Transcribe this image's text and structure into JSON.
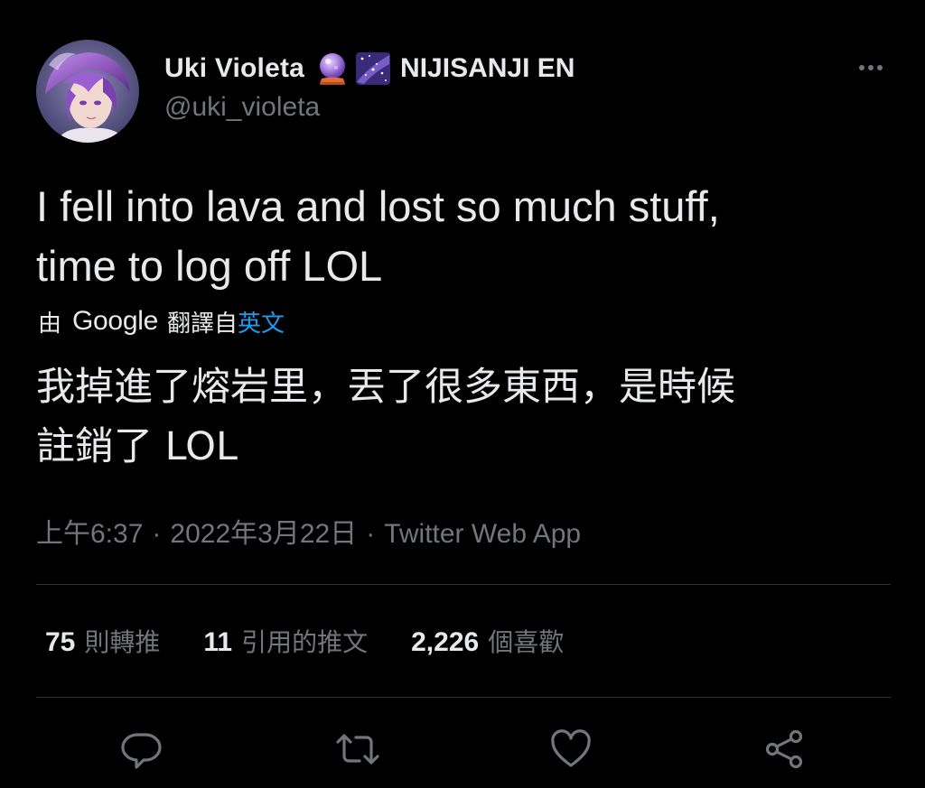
{
  "author": {
    "display_name": "Uki Violeta",
    "affiliation": "NIJISANJI EN",
    "handle": "@uki_violeta",
    "badge_icons": [
      "crystal-ball-icon",
      "milky-way-icon"
    ]
  },
  "tweet": {
    "text_line1": "I fell into lava and lost so much stuff,",
    "text_line2": "time to log off LOL",
    "translation": {
      "prefix": "由",
      "provider": "Google",
      "middle": "翻譯自",
      "source_language": "英文",
      "text_line1": "我掉進了熔岩里，丟了很多東西，是時候",
      "text_line2": "註銷了 LOL"
    },
    "time": "上午6:37",
    "date": "2022年3月22日",
    "separator": "·",
    "source": "Twitter Web App"
  },
  "stats": {
    "retweets": {
      "count": "75",
      "label": "則轉推"
    },
    "quotes": {
      "count": "11",
      "label": "引用的推文"
    },
    "likes": {
      "count": "2,226",
      "label": "個喜歡"
    }
  },
  "actions": [
    "reply-icon",
    "retweet-icon",
    "like-icon",
    "share-icon"
  ],
  "colors": {
    "background": "#000000",
    "text": "#e7e9ea",
    "secondary": "#71767b",
    "link": "#1d9bf0",
    "divider": "#2f3336"
  }
}
